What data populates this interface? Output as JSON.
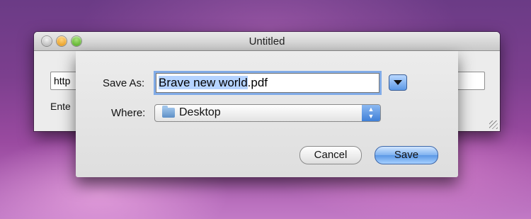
{
  "window": {
    "title": "Untitled",
    "url_value": "http",
    "hint_text": "Ente"
  },
  "sheet": {
    "save_as_label": "Save As:",
    "filename_selected": "Brave new world",
    "filename_ext": ".pdf",
    "where_label": "Where:",
    "location": "Desktop",
    "cancel_label": "Cancel",
    "save_label": "Save"
  },
  "colors": {
    "focus_ring": "#6ea0e6",
    "default_button": "#5b98e6",
    "selection": "#b5d3ff"
  }
}
